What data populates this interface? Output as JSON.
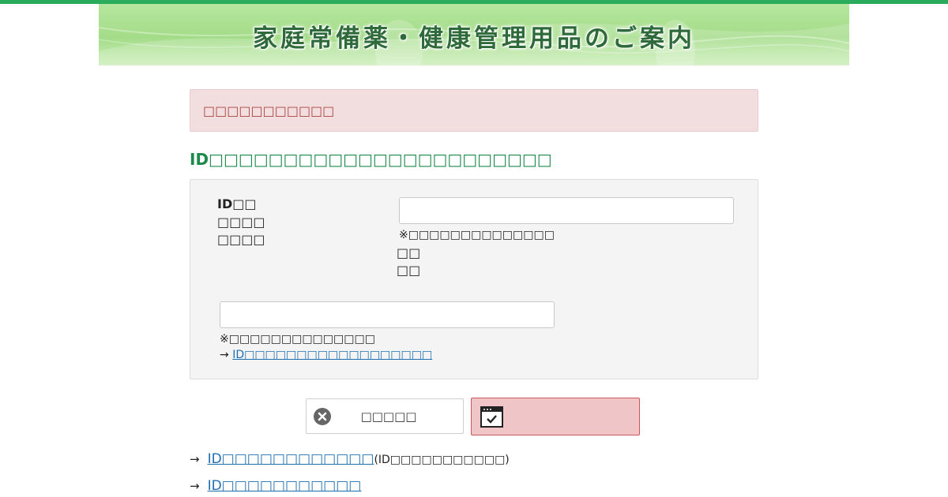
{
  "banner": {
    "title": "家庭常備薬・健康管理用品のご案内"
  },
  "alert": {
    "message": "□□□□□□□□□□□"
  },
  "heading": "ID□□□□□□□□□□□□□□□□□□□□□□□",
  "form": {
    "label_lines": [
      "ID□□",
      "□□□□",
      "□□□□"
    ],
    "input1": {
      "value": "",
      "placeholder": ""
    },
    "note1": "※□□□□□□□□□□□□□□",
    "note1_extra": [
      "□□",
      "□□"
    ],
    "input2": {
      "value": "",
      "placeholder": ""
    },
    "note2": "※□□□□□□□□□□□□□□",
    "link_arrow": "→",
    "link_text": "ID□□□□□□□□□□□□□□□□□□"
  },
  "buttons": {
    "cancel_label": "□□□□□",
    "submit_label": ""
  },
  "bottom_links": [
    {
      "arrow": "→",
      "text": "ID□□□□□□□□□□□□",
      "aside": "(ID□□□□□□□□□□□)"
    },
    {
      "arrow": "→",
      "text": "ID□□□□□□□□□□□",
      "aside": ""
    }
  ],
  "colors": {
    "accent": "#2bab5c",
    "heading": "#1d8a4c",
    "alert_bg": "#f2dede",
    "alert_text": "#a94442",
    "link": "#1f6fb0",
    "submit_bg": "#f0c5c7"
  },
  "icons": {
    "cancel": "close-circle-icon",
    "submit": "calendar-check-icon"
  }
}
